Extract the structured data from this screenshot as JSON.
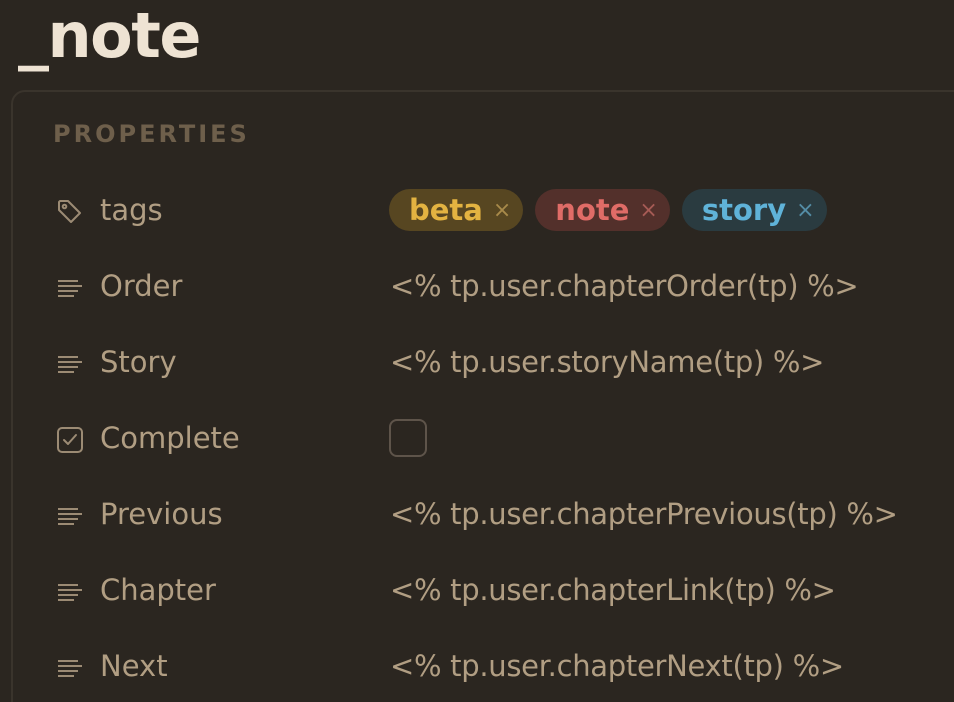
{
  "note": {
    "title": "_note"
  },
  "properties": {
    "heading": "PROPERTIES",
    "tags": {
      "label": "tags",
      "icon": "tag-icon",
      "items": [
        {
          "label": "beta",
          "remove": "×",
          "color": "#e3b341",
          "bg": "#574621"
        },
        {
          "label": "note",
          "remove": "×",
          "color": "#e06c67",
          "bg": "#53302b"
        },
        {
          "label": "story",
          "remove": "×",
          "color": "#5fb3d9",
          "bg": "#2a3b40"
        }
      ]
    },
    "rows": [
      {
        "label": "Order",
        "icon": "text-lines-icon",
        "value": "<% tp.user.chapterOrder(tp) %>"
      },
      {
        "label": "Story",
        "icon": "text-lines-icon",
        "value": "<% tp.user.storyName(tp) %>"
      },
      {
        "label": "Complete",
        "icon": "checkbox-icon",
        "checked": false
      },
      {
        "label": "Previous",
        "icon": "text-lines-icon",
        "value": "<% tp.user.chapterPrevious(tp) %>"
      },
      {
        "label": "Chapter",
        "icon": "text-lines-icon",
        "value": "<% tp.user.chapterLink(tp) %>"
      },
      {
        "label": "Next",
        "icon": "text-lines-icon",
        "value": "<% tp.user.chapterNext(tp) %>"
      }
    ]
  },
  "colors": {
    "background": "#2b2620",
    "text": "#b19e83",
    "title": "#eee3d3",
    "heading": "#6e5f4b",
    "icon": "#9c8b74"
  }
}
